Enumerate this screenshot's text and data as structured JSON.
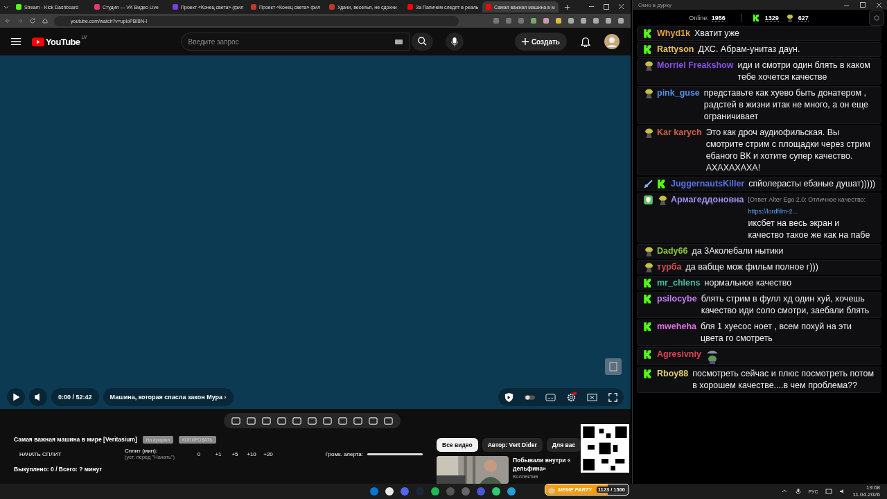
{
  "browser": {
    "tabs": [
      {
        "title": "Stream - Kick Dashboard",
        "kind": "kick",
        "selected": false
      },
      {
        "title": "Студия — VK Видео Live",
        "kind": "vk",
        "selected": false
      },
      {
        "title": "Проект «Конец света» (фил",
        "kind": "r",
        "selected": false
      },
      {
        "title": "Проект «Конец света» фил",
        "kind": "k",
        "selected": false
      },
      {
        "title": "Удачи, веселья, не сдохни",
        "kind": "k",
        "selected": false
      },
      {
        "title": "За Папичем следят в реаль",
        "kind": "yt",
        "selected": false
      },
      {
        "title": "Самая важная машина в м",
        "kind": "yt",
        "selected": true
      }
    ],
    "url": "youtube.com/watch?v=uploPBIBN-I"
  },
  "youtube": {
    "logo": "YouTube",
    "region": "LV",
    "search": {
      "placeholder": "Введите запрос"
    },
    "create": "Создать"
  },
  "player": {
    "time": "0:00 / 52:42",
    "chapter": "Машина, которая спасла закон Мура",
    "chapter_arrow": "›"
  },
  "extension": {
    "title": "Самая важная машина в мире [Veritasium]",
    "buttons": [
      "На аукцион",
      "КОПИРОВАТЬ"
    ],
    "start_split": "НАЧАТЬ СПЛИТ",
    "split_label": "Сплит (мин):",
    "split_hint": "(уст. перед \"Начать\")",
    "split_value": "0",
    "increments": [
      "+1",
      "+5",
      "+10",
      "+20"
    ],
    "alert_volume": {
      "label": "Громк. алерта:",
      "level": 1
    },
    "summary": "Выкуплено: 0 / Всего: ? минут"
  },
  "recommendations": {
    "chips": [
      {
        "label": "Все видео",
        "selected": true
      },
      {
        "label": "Автор: Vert Dider",
        "selected": false
      },
      {
        "label": "Для вас",
        "selected": false
      }
    ],
    "video": {
      "title_lines": [
        "Побывали внутри «",
        "дельфина»"
      ],
      "channel": "Коллектив"
    }
  },
  "chat": {
    "window_title": "Окно в дурку",
    "online_label": "Online:",
    "online": "1956",
    "kick_count": "1329",
    "emote_count": "627",
    "messages": [
      {
        "badges": [
          {
            "kind": "kick"
          }
        ],
        "user": "Whyd1k",
        "color": "#e0a040",
        "text": "Хватит уже"
      },
      {
        "badges": [
          {
            "kind": "kick"
          }
        ],
        "user": "Rattyson",
        "color": "#e8c060",
        "text": "ДХС. Абрам-унитаз даун."
      },
      {
        "badges": [
          {
            "kind": "emote"
          }
        ],
        "user": "Morriel Freakshow",
        "color": "#8a4ee8",
        "text": "иди и смотри один блять в каком тебе хочется качестве"
      },
      {
        "badges": [
          {
            "kind": "emote"
          }
        ],
        "user": "pink_guse",
        "color": "#5a8ee8",
        "text": "представьте как хуево быть донатером , радстей в жизни итак не много, а он еще ограничивает"
      },
      {
        "badges": [
          {
            "kind": "emote"
          }
        ],
        "user": "Kar karych",
        "color": "#d06040",
        "text": "Это как дроч аудиофильская. Вы смотрите стрим с площадки через стрим ебаного ВК и хотите супер качество. АХАХАХАХА!"
      },
      {
        "badges": [
          {
            "kind": "sword"
          },
          {
            "kind": "kick"
          }
        ],
        "user": "JuggernautsKiller",
        "color": "#5a70e8",
        "text": "спйолерасты ебаные душат)))))"
      },
      {
        "badges": [
          {
            "kind": "shield"
          },
          {
            "kind": "emote"
          }
        ],
        "user": "Армагеддоновна",
        "color": "#a090f0",
        "reply": "[Ответ Alter Ego 2.0: Отличное качество: ",
        "reply_link": "https://lordfilm-2...",
        "text": "иксбет на весь экран и качество такое же как на пабе"
      },
      {
        "badges": [
          {
            "kind": "emote"
          }
        ],
        "user": "Dady66",
        "color": "#90c040",
        "text": "да 3Аколебали нытики"
      },
      {
        "badges": [
          {
            "kind": "emote"
          }
        ],
        "user": "турба",
        "color": "#d05050",
        "text": "да вабще мож фильм полное г)))"
      },
      {
        "badges": [
          {
            "kind": "kick"
          }
        ],
        "user": "mr_chlens",
        "color": "#40c0a0",
        "text": "нормальное качество"
      },
      {
        "badges": [
          {
            "kind": "kick"
          }
        ],
        "user": "psilocybe",
        "color": "#c080f0",
        "text": "блять стрим в фулл хд один хуй, хочешь качество иди соло смотри, заебали блять"
      },
      {
        "badges": [
          {
            "kind": "kick"
          }
        ],
        "user": "mweheha",
        "color": "#e070e0",
        "text": "бля 1 хуесос ноет , всем похуй на эти цвета го смотреть"
      },
      {
        "badges": [
          {
            "kind": "kick"
          }
        ],
        "user": "Agresivniy",
        "color": "#e04050",
        "emote": true
      },
      {
        "badges": [
          {
            "kind": "kick"
          }
        ],
        "user": "Rboy88",
        "color": "#e0d070",
        "text": "посмотреть сейчас и плюс посмотреть потом в хорошем качестве....в чем проблема??"
      }
    ]
  },
  "meme_party": {
    "title": "MEME PARTY",
    "count": "1123 / 1500",
    "level": 0.75
  },
  "taskbar": {
    "language": "РУС",
    "time": "19:08",
    "date": "11.04.2026"
  }
}
